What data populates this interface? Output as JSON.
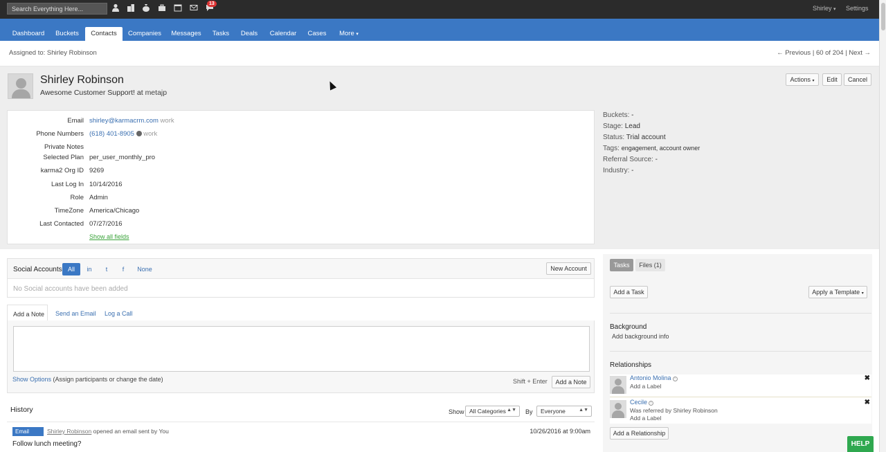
{
  "topbar": {
    "search_placeholder": "Search Everything Here...",
    "icons": [
      "person-icon",
      "buildings-icon",
      "money-bag-icon",
      "briefcase-icon",
      "calendar-icon",
      "envelope-icon",
      "chat-icon"
    ],
    "calendar_day": "17",
    "notification_count": "13",
    "user_label": "Shirley",
    "settings_label": "Settings"
  },
  "nav": {
    "tabs": [
      "Dashboard",
      "Buckets",
      "Contacts",
      "Companies",
      "Messages",
      "Tasks",
      "Deals",
      "Calendar",
      "Cases",
      "More"
    ],
    "active": "Contacts"
  },
  "assign_bar": {
    "assigned": "Assigned to: Shirley Robinson",
    "previous": "← Previous",
    "position": "60 of 204",
    "next": "Next →"
  },
  "contact": {
    "name": "Shirley Robinson",
    "title": "Awesome Customer Support!",
    "at": "at",
    "company": "metajp"
  },
  "actions": {
    "actions_label": "Actions",
    "edit_label": "Edit",
    "cancel_label": "Cancel"
  },
  "fields": [
    {
      "label": "Email",
      "value": "shirley@karmacrm.com",
      "note": "work"
    },
    {
      "label": "Phone Numbers",
      "value": "(618) 401-8905",
      "note": "work"
    },
    {
      "label": "Private Notes",
      "value": ""
    },
    {
      "label": "Selected Plan",
      "value": "per_user_monthly_pro"
    },
    {
      "label": "karma2 Org ID",
      "value": "9269"
    },
    {
      "label": "Last Log In",
      "value": "10/14/2016"
    },
    {
      "label": "Role",
      "value": "Admin"
    },
    {
      "label": "TimeZone",
      "value": "America/Chicago"
    },
    {
      "label": "Last Contacted",
      "value": "07/27/2016"
    }
  ],
  "show_all_fields": "Show all fields",
  "side_info": [
    {
      "label": "Buckets:",
      "value": "-"
    },
    {
      "label": "Stage:",
      "value": "Lead"
    },
    {
      "label": "Status:",
      "value": "Trial account"
    },
    {
      "label": "Tags:",
      "value": "engagement, account owner"
    },
    {
      "label": "Referral Source:",
      "value": "-"
    },
    {
      "label": "Industry:",
      "value": "-"
    }
  ],
  "social": {
    "title": "Social Accounts",
    "filters": [
      "All",
      "in",
      "t",
      "f",
      "None"
    ],
    "new_account": "New Account",
    "empty": "No Social accounts have been added"
  },
  "note": {
    "tabs": [
      "Add a Note",
      "Send an Email",
      "Log a Call"
    ],
    "show_options": "Show Options",
    "show_options_hint": "(Assign participants or change the date)",
    "shortcut": "Shift + Enter",
    "submit": "Add a Note"
  },
  "history": {
    "title": "History",
    "show_label": "Show",
    "category": "All Categories",
    "by_label": "By",
    "by_value": "Everyone",
    "item": {
      "badge": "Email",
      "actor": "Shirley Robinson",
      "action": "opened an email sent by You",
      "date": "10/26/2016 at 9:00am",
      "subject": "Follow lunch meeting?"
    }
  },
  "right": {
    "tabs": [
      "Tasks",
      "Files (1)"
    ],
    "add_task": "Add a Task",
    "apply_template": "Apply a Template",
    "background_title": "Background",
    "background_sub": "Add background info",
    "relationships_title": "Relationships",
    "relationships": [
      {
        "name": "Antonio Molina",
        "lines": [
          "Add a Label"
        ]
      },
      {
        "name": "Cecile",
        "lines": [
          "Was referred by Shirley Robinson",
          "Add a Label"
        ]
      }
    ],
    "add_relationship": "Add a Relationship"
  },
  "help_label": "HELP"
}
